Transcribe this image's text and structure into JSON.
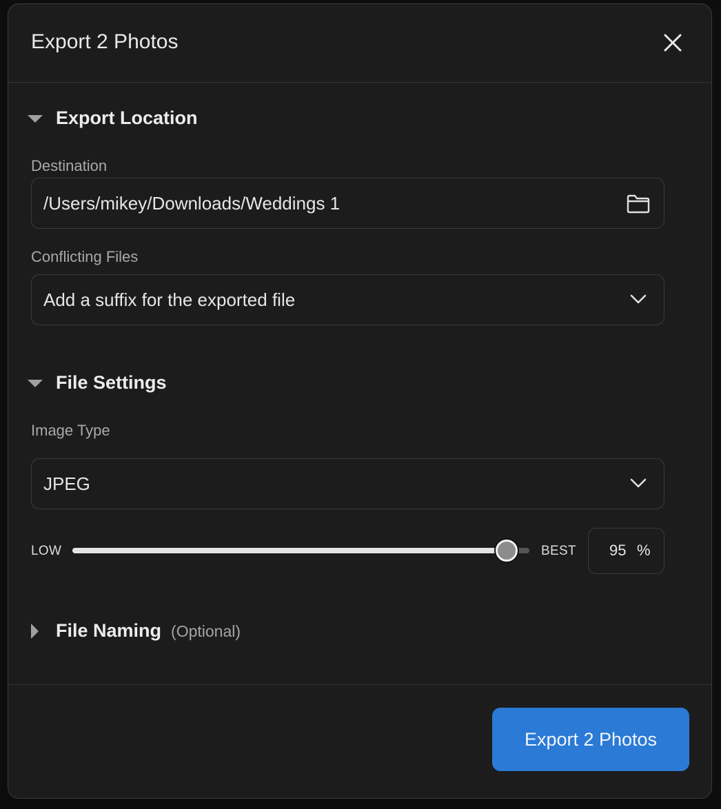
{
  "dialog": {
    "title": "Export 2 Photos",
    "close_icon": "close-icon"
  },
  "export_location": {
    "heading": "Export Location",
    "expanded": true,
    "destination_label": "Destination",
    "destination_value": "/Users/mikey/Downloads/Weddings 1",
    "destination_icon": "folder-icon",
    "conflicting_label": "Conflicting Files",
    "conflicting_value": "Add a suffix for the exported file"
  },
  "file_settings": {
    "heading": "File Settings",
    "expanded": true,
    "image_type_label": "Image Type",
    "image_type_value": "JPEG",
    "quality_low_label": "LOW",
    "quality_best_label": "BEST",
    "quality_value": "95",
    "quality_unit": "%",
    "quality_fraction": 0.95
  },
  "file_naming": {
    "heading": "File Naming",
    "subheading": "(Optional)",
    "expanded": false
  },
  "footer": {
    "export_button_label": "Export 2 Photos"
  },
  "colors": {
    "background": "#1c1c1c",
    "accent": "#2a7ad6",
    "border": "#3b3b3b",
    "text_primary": "#e6e6e6",
    "text_secondary": "#a9a9a9"
  }
}
